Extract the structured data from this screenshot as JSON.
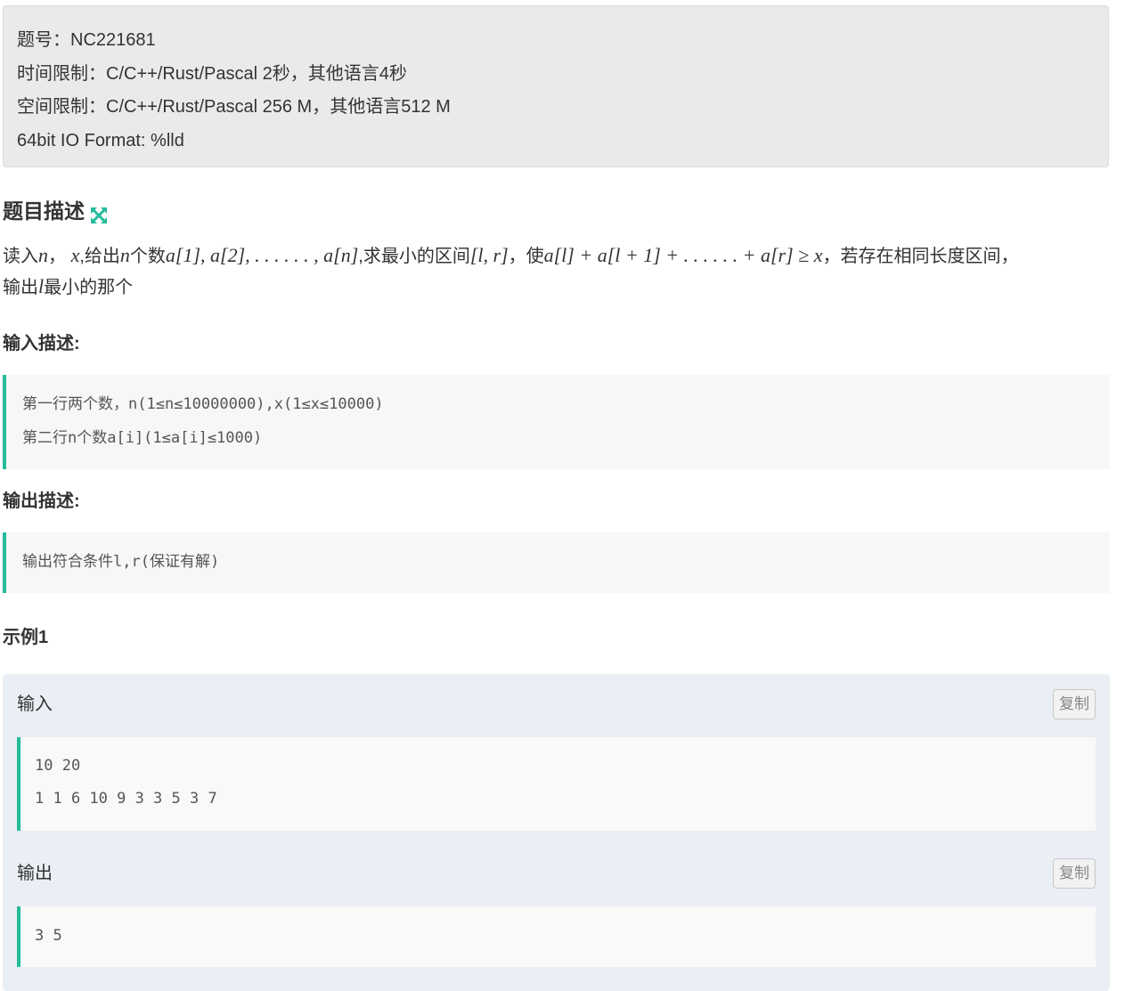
{
  "meta": {
    "problem_id": "题号：NC221681",
    "time_limit": "时间限制：C/C++/Rust/Pascal 2秒，其他语言4秒",
    "space_limit": "空间限制：C/C++/Rust/Pascal 256 M，其他语言512 M",
    "io_format": "64bit IO Format: %lld"
  },
  "description": {
    "title": "题目描述",
    "line1": {
      "t1": "读入",
      "m1": "n",
      "t2": "， ",
      "m2": "x",
      "t3": ",给出",
      "m3": "n",
      "t4": "个数",
      "m4": "a[1], a[2], . . . . . . , a[n]",
      "t5": ",求最小的区间",
      "m5": "[l, r]",
      "t6": "，使",
      "m6": "a[l] + a[l + 1] + . . . . . . + a[r] ≥ x",
      "t7": "，若存在相同长度区间，"
    },
    "line2": {
      "t1": "输出",
      "m1": "l",
      "t2": "最小的那个"
    }
  },
  "input_desc": {
    "title": "输入描述:",
    "lines": [
      "第一行两个数，n(1≤n≤10000000),x(1≤x≤10000)",
      "第二行n个数a[i](1≤a[i]≤1000)"
    ]
  },
  "output_desc": {
    "title": "输出描述:",
    "lines": [
      "输出符合条件l,r(保证有解)"
    ]
  },
  "example": {
    "title": "示例1",
    "input_label": "输入",
    "output_label": "输出",
    "copy_label": "复制",
    "input_lines": [
      "10 20",
      "1 1 6 10 9 3 3 5 3 7"
    ],
    "output_lines": [
      "3 5"
    ]
  },
  "icons": {
    "expand": "expand-icon"
  },
  "colors": {
    "accent": "#25bb9b",
    "meta_bg": "#eaeaea",
    "example_bg": "#eaeff5"
  }
}
